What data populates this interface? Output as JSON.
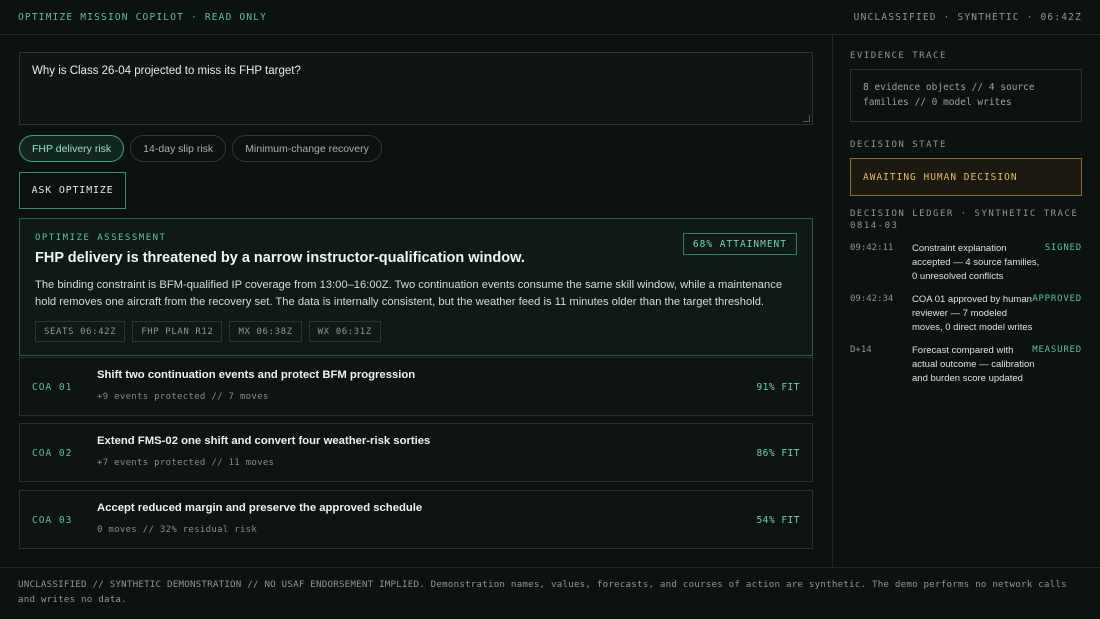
{
  "header": {
    "app_title": "OPTIMIZE MISSION COPILOT · READ ONLY",
    "status": "UNCLASSIFIED · SYNTHETIC · 06:42Z"
  },
  "query": {
    "value": "Why is Class 26-04 projected to miss its FHP target?"
  },
  "chips": [
    {
      "label": "FHP delivery risk",
      "active": true
    },
    {
      "label": "14-day slip risk",
      "active": false
    },
    {
      "label": "Minimum-change recovery",
      "active": false
    }
  ],
  "ask_button": "ASK OPTIMIZE",
  "assessment": {
    "label": "OPTIMIZE ASSESSMENT",
    "badge": "68% ATTAINMENT",
    "headline": "FHP delivery is threatened by a narrow instructor-qualification window.",
    "body": "The binding constraint is BFM-qualified IP coverage from 13:00–16:00Z. Two continuation events consume the same skill window, while a maintenance hold removes one aircraft from the recovery set. The data is internally consistent, but the weather feed is 11 minutes older than the target threshold.",
    "sources": [
      "SEATS 06:42Z",
      "FHP PLAN R12",
      "MX 06:38Z",
      "WX 06:31Z"
    ]
  },
  "coas": [
    {
      "id": "COA 01",
      "title": "Shift two continuation events and protect BFM progression",
      "detail": "+9 events protected // 7 moves",
      "fit": "91% FIT"
    },
    {
      "id": "COA 02",
      "title": "Extend FMS-02 one shift and convert four weather-risk sorties",
      "detail": "+7 events protected // 11 moves",
      "fit": "86% FIT"
    },
    {
      "id": "COA 03",
      "title": "Accept reduced margin and preserve the approved schedule",
      "detail": "0 moves // 32% residual risk",
      "fit": "54% FIT"
    }
  ],
  "sidebar": {
    "evidence_heading": "EVIDENCE TRACE",
    "evidence_text": "8 evidence objects // 4 source families // 0 model writes",
    "decision_heading": "DECISION STATE",
    "decision_state": "AWAITING HUMAN DECISION",
    "ledger_heading": "DECISION LEDGER · SYNTHETIC TRACE 0814-03",
    "ledger": [
      {
        "time": "09:42:11",
        "text": "Constraint explanation accepted — 4 source families, 0 unresolved conflicts",
        "status": "SIGNED"
      },
      {
        "time": "09:42:34",
        "text": "COA 01 approved by human reviewer — 7 modeled moves, 0 direct model writes",
        "status": "APPROVED"
      },
      {
        "time": "D+14",
        "text": "Forecast compared with actual outcome — calibration and burden score updated",
        "status": "MEASURED"
      }
    ]
  },
  "footer": "UNCLASSIFIED // SYNTHETIC DEMONSTRATION // NO USAF ENDORSEMENT IMPLIED. Demonstration names, values, forecasts, and courses of action are synthetic. The demo performs no network calls and writes no data.",
  "colors": {
    "accent": "#5fbfa6",
    "warning": "#e4b868",
    "background": "#0c1210"
  }
}
